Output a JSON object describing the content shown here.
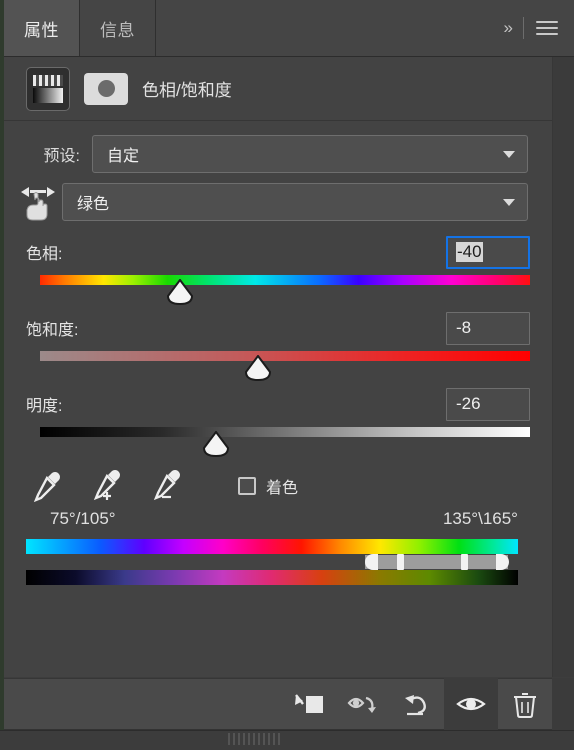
{
  "window": {
    "tabs": [
      {
        "label": "属性",
        "active": true
      },
      {
        "label": "信息",
        "active": false
      }
    ],
    "overflow_label": "»",
    "menu_icon": "hamburger-menu-icon"
  },
  "adjustment": {
    "title": "色相/饱和度",
    "thumbnail_icon": "hue-saturation-adjustment-icon",
    "mask_icon": "layer-mask-icon"
  },
  "preset": {
    "label": "预设:",
    "value": "自定",
    "chevron": "chevron-down-icon"
  },
  "color_range": {
    "targeted_tool_icon": "on-image-adjustment-hand-icon",
    "value": "绿色",
    "chevron": "chevron-down-icon"
  },
  "sliders": [
    {
      "key": "hue",
      "label": "色相:",
      "value": "-40",
      "focused": true,
      "thumb_percent": 28.5,
      "track": "hue-spectrum"
    },
    {
      "key": "saturation",
      "label": "饱和度:",
      "value": "-8",
      "focused": false,
      "thumb_percent": 44.5,
      "track": "saturation-ramp"
    },
    {
      "key": "lightness",
      "label": "明度:",
      "value": "-26",
      "focused": false,
      "thumb_percent": 36.0,
      "track": "lightness-ramp"
    }
  ],
  "tools": {
    "eyedropper": "eyedropper-icon",
    "eyedropper_add": "eyedropper-add-icon",
    "eyedropper_subtract": "eyedropper-subtract-icon",
    "colorize_label": "着色",
    "colorize_checked": false
  },
  "range": {
    "left_label": "75°/105°",
    "right_label": "135°\\165°",
    "handles": {
      "outer_left_percent": 69.0,
      "inner_left_percent": 76.0,
      "inner_right_percent": 89.0,
      "outer_right_percent": 95.5
    }
  },
  "bottom_toolbar": [
    {
      "name": "clip-to-layer-button",
      "icon": "clip-to-layer-icon",
      "active": false
    },
    {
      "name": "view-previous-state-button",
      "icon": "eye-previous-state-icon",
      "active": false
    },
    {
      "name": "reset-button",
      "icon": "reset-arrow-icon",
      "active": false
    },
    {
      "name": "toggle-visibility-button",
      "icon": "eye-icon",
      "active": true
    },
    {
      "name": "delete-layer-button",
      "icon": "trash-icon",
      "active": false
    }
  ],
  "colors": {
    "panel_bg": "#434343",
    "tabbar_bg": "#454545",
    "active_tab_bg": "#535353",
    "focus_blue": "#1473e6",
    "text": "#e4e4e4"
  }
}
